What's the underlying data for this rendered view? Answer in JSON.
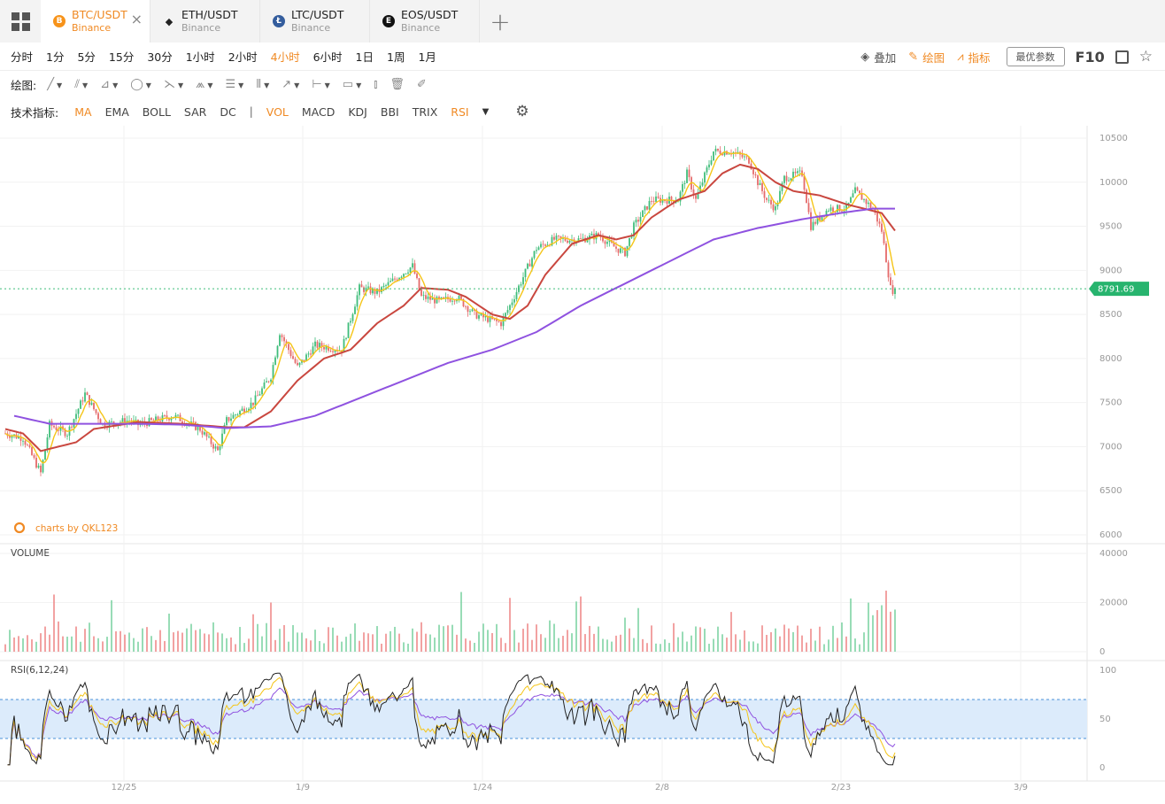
{
  "tabs": [
    {
      "pair": "BTC/USDT",
      "exchange": "Binance",
      "coin": "B",
      "color": "#f7931a",
      "active": true,
      "closable": true
    },
    {
      "pair": "ETH/USDT",
      "exchange": "Binance",
      "coin": "eth-diamond-icon",
      "color": "#222222",
      "active": false
    },
    {
      "pair": "LTC/USDT",
      "exchange": "Binance",
      "coin": "Ł",
      "color": "#345d9d",
      "active": false
    },
    {
      "pair": "EOS/USDT",
      "exchange": "Binance",
      "coin": "E",
      "color": "#111111",
      "active": false
    }
  ],
  "periods": [
    "分时",
    "1分",
    "5分",
    "15分",
    "30分",
    "1小时",
    "2小时",
    "4小时",
    "6小时",
    "1日",
    "1周",
    "1月"
  ],
  "active_period": "4小时",
  "right_tools": {
    "overlay": "叠加",
    "draw": "绘图",
    "indicator": "指标",
    "best_params": "最优参数",
    "f10": "F10"
  },
  "draw_label": "绘图:",
  "indicator_label": "技术指标:",
  "indicators": [
    {
      "name": "MA",
      "on": true
    },
    {
      "name": "EMA",
      "on": false
    },
    {
      "name": "BOLL",
      "on": false
    },
    {
      "name": "SAR",
      "on": false
    },
    {
      "name": "DC",
      "on": false
    }
  ],
  "sub_indicators": [
    {
      "name": "VOL",
      "on": true
    },
    {
      "name": "MACD",
      "on": false
    },
    {
      "name": "KDJ",
      "on": false
    },
    {
      "name": "BBI",
      "on": false
    },
    {
      "name": "TRIX",
      "on": false
    },
    {
      "name": "RSI",
      "on": true
    }
  ],
  "chart_data": {
    "type": "candlestick",
    "brand": "charts by QKL123",
    "last_price": "8791.69",
    "x_ticks": [
      "12/25",
      "1/9",
      "1/24",
      "2/8",
      "2/23",
      "3/9"
    ],
    "price_axis": {
      "ticks": [
        10500,
        10000,
        9500,
        9000,
        8500,
        8000,
        7500,
        7000,
        6500,
        6000
      ],
      "ylim": [
        6000,
        10500
      ]
    },
    "price_path": [
      [
        0,
        7150
      ],
      [
        2,
        7100
      ],
      [
        4,
        6700
      ],
      [
        5,
        7250
      ],
      [
        7,
        7150
      ],
      [
        9,
        7600
      ],
      [
        11,
        7250
      ],
      [
        14,
        7300
      ],
      [
        15,
        7250
      ],
      [
        19,
        7350
      ],
      [
        22,
        7200
      ],
      [
        24,
        6950
      ],
      [
        25,
        7300
      ],
      [
        28,
        7500
      ],
      [
        30,
        7800
      ],
      [
        31,
        8300
      ],
      [
        33,
        7900
      ],
      [
        35,
        8150
      ],
      [
        38,
        8100
      ],
      [
        40,
        8800
      ],
      [
        42,
        8750
      ],
      [
        44,
        8900
      ],
      [
        46,
        9050
      ],
      [
        47,
        8700
      ],
      [
        49,
        8650
      ],
      [
        51,
        8700
      ],
      [
        53,
        8500
      ],
      [
        56,
        8400
      ],
      [
        57,
        8600
      ],
      [
        60,
        9250
      ],
      [
        62,
        9350
      ],
      [
        65,
        9350
      ],
      [
        67,
        9400
      ],
      [
        69,
        9250
      ],
      [
        70,
        9200
      ],
      [
        71,
        9500
      ],
      [
        73,
        9800
      ],
      [
        76,
        9800
      ],
      [
        77,
        10100
      ],
      [
        78,
        9800
      ],
      [
        80,
        10350
      ],
      [
        82,
        10350
      ],
      [
        84,
        10250
      ],
      [
        85,
        10000
      ],
      [
        86,
        9800
      ],
      [
        87,
        9700
      ],
      [
        88,
        10050
      ],
      [
        90,
        10100
      ],
      [
        91,
        9500
      ],
      [
        93,
        9700
      ],
      [
        95,
        9700
      ],
      [
        96,
        9900
      ],
      [
        97,
        9800
      ],
      [
        98,
        9700
      ],
      [
        99,
        9450
      ],
      [
        100,
        8800
      ],
      [
        100.5,
        8750
      ]
    ],
    "ma_slow_path": [
      [
        1,
        7350
      ],
      [
        5,
        7260
      ],
      [
        10,
        7260
      ],
      [
        15,
        7260
      ],
      [
        20,
        7250
      ],
      [
        25,
        7210
      ],
      [
        30,
        7230
      ],
      [
        35,
        7350
      ],
      [
        40,
        7550
      ],
      [
        45,
        7750
      ],
      [
        50,
        7950
      ],
      [
        55,
        8100
      ],
      [
        60,
        8300
      ],
      [
        65,
        8600
      ],
      [
        70,
        8850
      ],
      [
        75,
        9100
      ],
      [
        80,
        9350
      ],
      [
        85,
        9480
      ],
      [
        90,
        9580
      ],
      [
        95,
        9660
      ],
      [
        98,
        9700
      ],
      [
        100.5,
        9700
      ]
    ],
    "ma_mid_path": [
      [
        0,
        7200
      ],
      [
        2,
        7150
      ],
      [
        4,
        6950
      ],
      [
        8,
        7050
      ],
      [
        10,
        7200
      ],
      [
        15,
        7280
      ],
      [
        20,
        7260
      ],
      [
        25,
        7220
      ],
      [
        27,
        7220
      ],
      [
        30,
        7400
      ],
      [
        33,
        7750
      ],
      [
        36,
        8000
      ],
      [
        39,
        8100
      ],
      [
        42,
        8400
      ],
      [
        45,
        8600
      ],
      [
        47,
        8800
      ],
      [
        50,
        8780
      ],
      [
        52,
        8700
      ],
      [
        55,
        8500
      ],
      [
        57,
        8450
      ],
      [
        59,
        8600
      ],
      [
        61,
        8950
      ],
      [
        64,
        9300
      ],
      [
        67,
        9400
      ],
      [
        69,
        9350
      ],
      [
        71,
        9400
      ],
      [
        73,
        9600
      ],
      [
        76,
        9800
      ],
      [
        79,
        9900
      ],
      [
        81,
        10100
      ],
      [
        83,
        10200
      ],
      [
        85,
        10150
      ],
      [
        87,
        10000
      ],
      [
        89,
        9900
      ],
      [
        92,
        9850
      ],
      [
        95,
        9750
      ],
      [
        97,
        9700
      ],
      [
        99,
        9650
      ],
      [
        100.5,
        9450
      ]
    ],
    "volume_axis": {
      "ticks": [
        40000,
        20000,
        0
      ],
      "ylim": [
        0,
        40000
      ]
    },
    "rsi_axis": {
      "ticks": [
        100,
        50,
        0
      ],
      "ylim": [
        0,
        100
      ],
      "band": [
        30,
        70
      ]
    },
    "rsi_label": "RSI(6,12,24)",
    "volume_label": "VOLUME"
  }
}
